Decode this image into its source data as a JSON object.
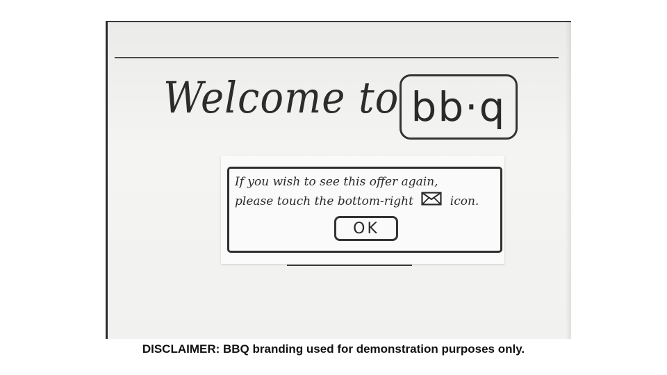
{
  "welcome": {
    "text": "Welcome to",
    "logo_text": "bb·q"
  },
  "dialog": {
    "line1": "If you wish to see this offer again,",
    "line2_before_icon": "please touch the bottom-right",
    "line2_after_icon": "icon.",
    "icon": "envelope-icon",
    "ok_label": "OK"
  },
  "footer": {
    "disclaimer": "DISCLAIMER: BBQ branding used for demonstration purposes only."
  }
}
